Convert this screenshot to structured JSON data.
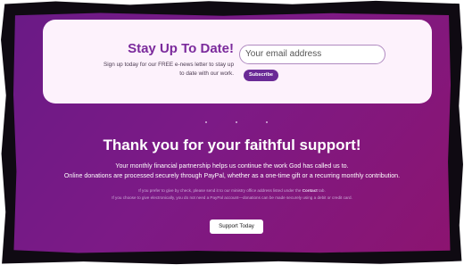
{
  "newsletter": {
    "title": "Stay Up To Date!",
    "description": "Sign up today for our FREE e-news letter to stay up to date with our work.",
    "email_placeholder": "Your email address",
    "email_value": "",
    "subscribe_label": "Subscribe"
  },
  "support": {
    "title": "Thank you for your faithful support!",
    "line1": "Your monthly financial partnership helps us continue the work God has called us to.",
    "line2": "Online donations are processed securely through PayPal, whether as a one-time gift or a recurring monthly contribution.",
    "fine_print_1_before": "If you prefer to give by check, please send it to our ministry office address listed under the ",
    "fine_print_1_link": "Contact",
    "fine_print_1_after": " tab.",
    "fine_print_2": "If you choose to give electronically, you do not need a PayPal account—donations can be made securely using a debit or credit card.",
    "button_label": "Support Today"
  },
  "colors": {
    "accent": "#7b2a9c",
    "button": "#6a2a96",
    "background_start": "#6a1a86",
    "background_end": "#8c1470"
  }
}
